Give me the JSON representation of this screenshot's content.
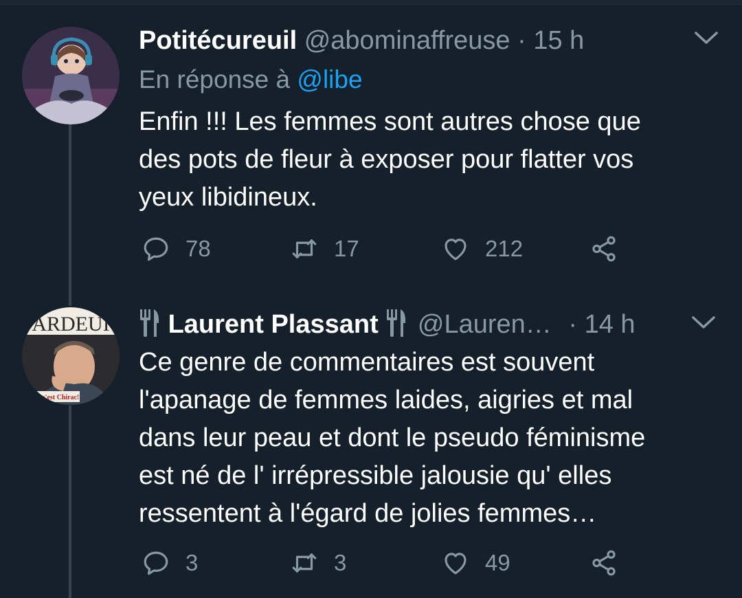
{
  "colors": {
    "background": "#15202b",
    "text": "#ffffff",
    "muted": "#8899a6",
    "link": "#1da1f2",
    "thread": "#38444d"
  },
  "tweets": [
    {
      "name": "Potitécureuil",
      "handle": "@abominaffreuse",
      "separator": "·",
      "time": "15 h",
      "reply_prefix": "En réponse à",
      "reply_handle": "@libe",
      "lines": [
        "Enfin !!! Les femmes sont autres chose que",
        "des pots de fleur à exposer pour flatter vos",
        "yeux libidineux."
      ],
      "replies": "78",
      "retweets": "17",
      "likes": "212",
      "avatar_icon": "avatar-gamer-girl-icon"
    },
    {
      "name": "Laurent Plassant",
      "handle": "@Lauren…",
      "separator": "·",
      "time": "14 h",
      "lines": [
        "Ce genre de commentaires est souvent",
        "l'apanage de femmes laides, aigries et mal",
        "dans leur peau et dont le pseudo féminisme",
        "est né de l' irrépressible jalousie qu' elles",
        "ressentent à l'égard de jolies femmes…"
      ],
      "replies": "3",
      "retweets": "3",
      "likes": "49",
      "avatar_icon": "avatar-magazine-cover-icon",
      "avatar_text_top": "ARDEUI",
      "avatar_text_bottom": "Qui c'est Chirac!"
    }
  ]
}
